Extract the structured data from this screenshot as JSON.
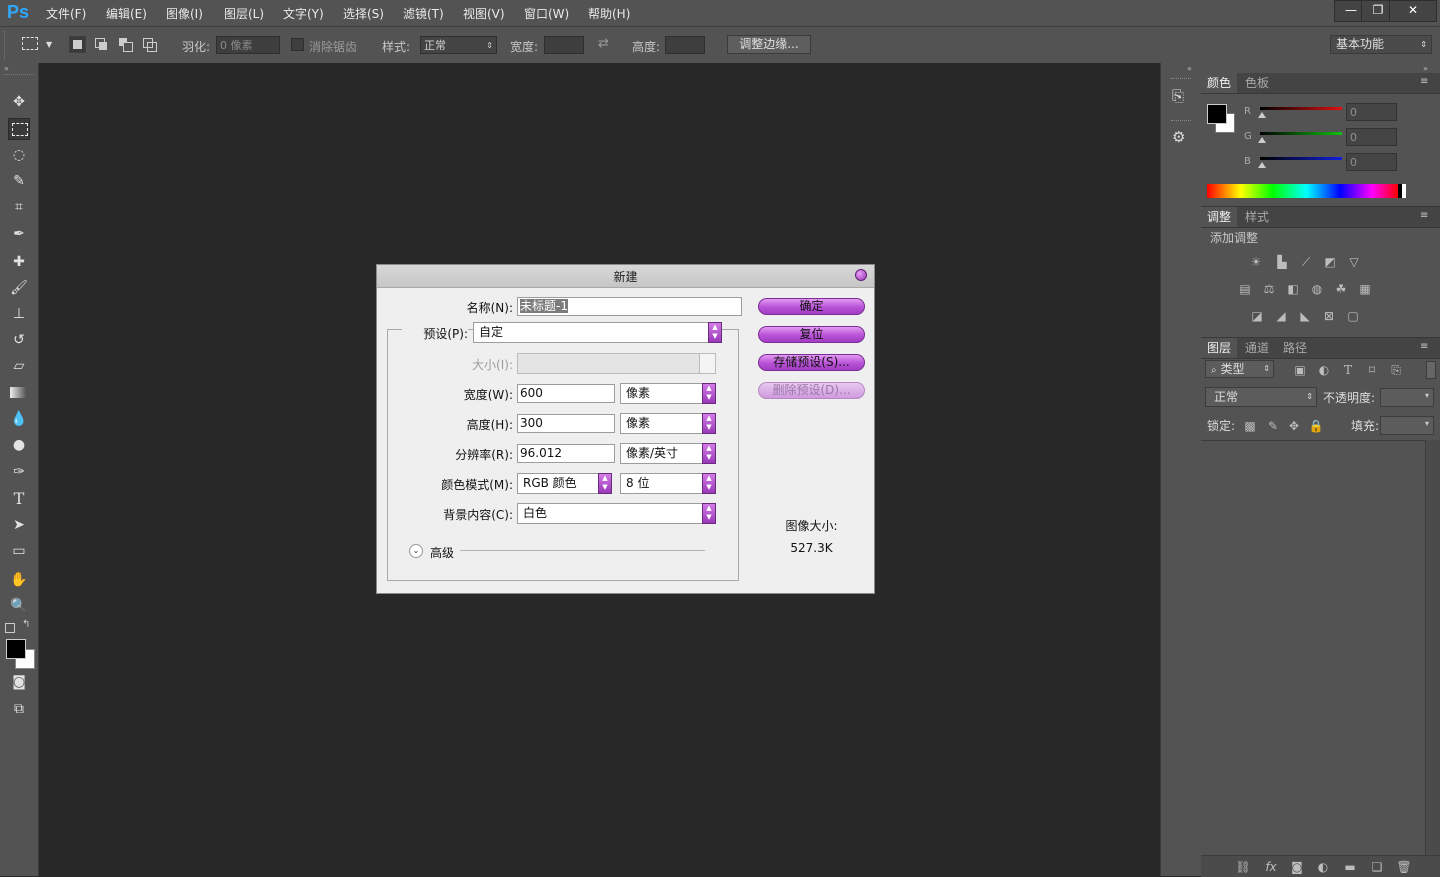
{
  "app": {
    "logo": "Ps"
  },
  "menubar": {
    "items": [
      "文件(F)",
      "编辑(E)",
      "图像(I)",
      "图层(L)",
      "文字(Y)",
      "选择(S)",
      "滤镜(T)",
      "视图(V)",
      "窗口(W)",
      "帮助(H)"
    ],
    "window_controls": {
      "minimize": "—",
      "restore": "❐",
      "close": "✕"
    }
  },
  "options": {
    "feather_label": "羽化:",
    "feather_value": "0 像素",
    "antialias_label": "消除锯齿",
    "style_label": "样式:",
    "style_value": "正常",
    "width_label": "宽度:",
    "height_label": "高度:",
    "refine_edge": "调整边缘...",
    "workspace": "基本功能"
  },
  "tools": [
    "move-tool",
    "marquee-tool",
    "lasso-tool",
    "quick-select-tool",
    "crop-tool",
    "eyedropper-tool",
    "healing-brush-tool",
    "brush-tool",
    "clone-stamp-tool",
    "history-brush-tool",
    "eraser-tool",
    "gradient-tool",
    "blur-tool",
    "dodge-tool",
    "pen-tool",
    "type-tool",
    "path-select-tool",
    "shape-tool",
    "hand-tool",
    "zoom-tool"
  ],
  "panels": {
    "color": {
      "tabs": [
        "颜色",
        "色板"
      ],
      "channels": [
        {
          "label": "R",
          "value": "0",
          "color": "#e01010"
        },
        {
          "label": "G",
          "value": "0",
          "color": "#10c010"
        },
        {
          "label": "B",
          "value": "0",
          "color": "#1020e0"
        }
      ]
    },
    "adjustments": {
      "tabs": [
        "调整",
        "样式"
      ],
      "title": "添加调整"
    },
    "layers": {
      "tabs": [
        "图层",
        "通道",
        "路径"
      ],
      "filter_kind": "类型",
      "blend_mode": "正常",
      "opacity_label": "不透明度:",
      "lock_label": "锁定:",
      "fill_label": "填充:"
    }
  },
  "dialog": {
    "title": "新建",
    "name_label": "名称(N):",
    "name_value": "未标题-1",
    "preset_label": "预设(P):",
    "preset_value": "自定",
    "size_label": "大小(I):",
    "width_label": "宽度(W):",
    "width_value": "600",
    "width_unit": "像素",
    "height_label": "高度(H):",
    "height_value": "300",
    "height_unit": "像素",
    "resolution_label": "分辨率(R):",
    "resolution_value": "96.012",
    "resolution_unit": "像素/英寸",
    "color_mode_label": "颜色模式(M):",
    "color_mode_value": "RGB 颜色",
    "bit_depth": "8 位",
    "background_label": "背景内容(C):",
    "background_value": "白色",
    "advanced_label": "高级",
    "ok_button": "确定",
    "reset_button": "复位",
    "save_preset_button": "存储预设(S)...",
    "delete_preset_button": "删除预设(D)...",
    "image_size_label": "图像大小:",
    "image_size_value": "527.3K"
  },
  "colors": {
    "accent": "#b852d6",
    "ui_bg": "#535353",
    "canvas_bg": "#282828"
  }
}
